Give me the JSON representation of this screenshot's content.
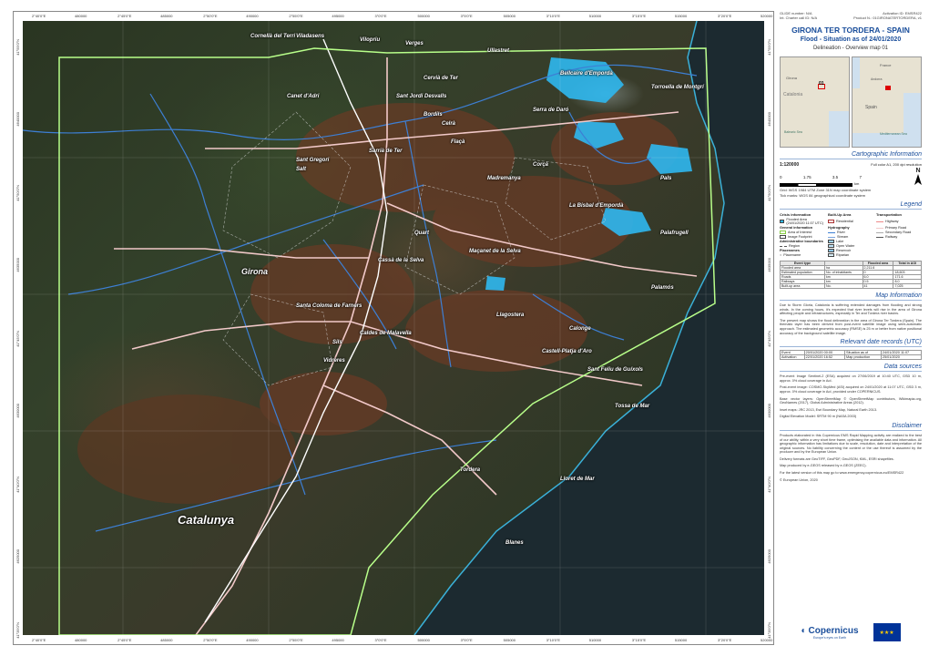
{
  "header": {
    "glide": "GLIDE number: N/A",
    "activation": "Activation ID: EMSR422",
    "charter": "Int. Charter call ID: N/A",
    "product": "Product N.: 01GIRONATERTORDERA, v1",
    "title": "GIRONA TER TORDERA - SPAIN",
    "subtitle": "Flood - Situation as of 24/01/2020",
    "subtitle2": "Delineation - Overview map 01"
  },
  "overview": {
    "labels": [
      "France",
      "Girona",
      "Catalonia",
      "Andorra",
      "Spain",
      "Mediterranean Sea",
      "Balearic Sea",
      "01"
    ]
  },
  "cartographic": {
    "section": "Cartographic Information",
    "scale": "1:120000",
    "print": "Full color A1, 200 dpi resolution",
    "scale_labels": [
      "0",
      "1.75",
      "3.5",
      "7"
    ],
    "scale_unit": "km",
    "crs1": "Grid: WGS 1984 UTM Zone 31N map coordinate system",
    "crs2": "Tick marks: WGS 84 geographical coordinate system",
    "north": "N"
  },
  "legend": {
    "section": "Legend",
    "col1_head": "Crisis information",
    "col2_head": "Built-Up Area",
    "col3_head": "Transportation",
    "items1": [
      "Flooded Area (24/01/2020 11:07 UTC)",
      "General information",
      "Area of Interest",
      "Image Footprint",
      "Administrative boundaries",
      "Region",
      "Placenames",
      "Placename"
    ],
    "items2": [
      "Residential",
      "Hydrography",
      "River",
      "Stream",
      "Lake",
      "Open Water",
      "Reservoir",
      "Riparian"
    ],
    "items3": [
      "Highway",
      "Primary Road",
      "Secondary Road",
      "Railway"
    ]
  },
  "table": {
    "h1": "Event type",
    "h2": "Flooded area",
    "h3": "Total in AOI",
    "r1": [
      "Flooded area",
      "ha",
      "2,211.6"
    ],
    "r2": [
      "Estimated population",
      "No. of inhabitants",
      "0",
      "18,603"
    ],
    "r3": [
      "Roads",
      "km",
      "6.0",
      "171.6"
    ],
    "r4": [
      "Railways",
      "km",
      "0.5",
      "8.0"
    ],
    "r5": [
      "Built-up area",
      "No.",
      "41",
      "7,025"
    ]
  },
  "map_info": {
    "section": "Map Information",
    "p1": "Due to Storm Gloria, Catalonia is suffering extended damages from flooding and strong winds. In the coming hours, it's expected that river levels will rise in the area of Girona affecting people and infrastructures, especially in Ter and Tordera river basins.",
    "p2": "The present map shows the flood delineation in the area of Girona Ter Tordera (Spain). The thematic layer has been derived from post-event satellite image using semi-automatic approach. The estimated geometric accuracy (RMSE) is 25 m or better from native positional accuracy of the background satellite image."
  },
  "dates": {
    "section": "Relevant date records (UTC)",
    "event_l": "Event",
    "event_v": "20/01/2020 00:00",
    "situation_l": "Situation as of",
    "situation_v": "24/01/2020 11:07",
    "activation_l": "Activation",
    "activation_v": "22/01/2020 16:52",
    "map_l": "Map production",
    "map_v": "25/01/2020"
  },
  "sources": {
    "section": "Data sources",
    "p1": "Pre-event Image Sentinel-2 (ESA) acquired on 27/06/2019 at 10:40 UTC, GSD 10 m, approx. 0% cloud coverage in AoI.",
    "p2": "Post-event image: COSMO-SkyMed (ASI) acquired on 24/01/2020 at 11:07 UTC, GSD 3 m, approx. 0% cloud coverage in AoI, provided under COPERNICUS.",
    "p3": "Base vector layers: OpenStreetMap © OpenStreetMap contributors, Wikimapia.org, GeoNames (2017), Global Administrative Areas (2012).",
    "p4": "Inset maps: JRC 2013, Esri Boundary Map, Natural Earth 2013.",
    "p5": "Digital Elevation Model: SRTM 90 m (NASA 2003)"
  },
  "disclaimer": {
    "section": "Disclaimer",
    "p1": "Products elaborated in this Copernicus EMS Rapid Mapping activity are realized to the best of our ability, within a very short time frame, optimising the available data and information. All geographic information has limitations due to scale, resolution, date and interpretation of the original sources. No liability concerning the content or the use thereof is assumed by the producer and by the European Union.",
    "p2": "Delivery formats are GeoTIFF, GeoPDF, GeoJSON, KML, ESRI shapefiles.",
    "p3": "Map produced by e-GEOS released by e-GEOS (ZEEC).",
    "p4": "For the latest version of this map go to www.emergency.copernicus.eu/EMSR422",
    "p5": "© European Union, 2020"
  },
  "logos": {
    "copernicus": "Copernicus",
    "copernicus_sub": "Europe's eyes on Earth"
  },
  "ticks": {
    "top": [
      "2°40'0\"E",
      "480000",
      "2°45'0\"E",
      "485000",
      "2°50'0\"E",
      "490000",
      "2°55'0\"E",
      "495000",
      "3°0'0\"E",
      "500000",
      "3°5'0\"E",
      "505000",
      "3°10'0\"E",
      "510000",
      "3°15'0\"E",
      "515000",
      "3°20'0\"E",
      "520000"
    ],
    "left": [
      "41°55'0\"N",
      "4640000",
      "41°50'0\"N",
      "4635000",
      "41°45'0\"N",
      "4630000",
      "41°40'0\"N",
      "4625000",
      "41°35'0\"N"
    ]
  },
  "places": [
    {
      "t": "Cornellà del Terri",
      "c": "place"
    },
    {
      "t": "Viladasens",
      "c": "place"
    },
    {
      "t": "Vilopriu",
      "c": "place"
    },
    {
      "t": "Verges",
      "c": "place"
    },
    {
      "t": "Ullastret",
      "c": "place"
    },
    {
      "t": "Torroella de Montgrí",
      "c": "place"
    },
    {
      "t": "Pals",
      "c": "place"
    },
    {
      "t": "Bellcaire d'Empordà",
      "c": "place"
    },
    {
      "t": "Serra de Daró",
      "c": "place"
    },
    {
      "t": "Cervià de Ter",
      "c": "place"
    },
    {
      "t": "Canet d'Adri",
      "c": "place"
    },
    {
      "t": "Sant Gregori",
      "c": "place"
    },
    {
      "t": "Sarrià de Ter",
      "c": "place"
    },
    {
      "t": "Girona",
      "c": "place big"
    },
    {
      "t": "Salt",
      "c": "place"
    },
    {
      "t": "Celrà",
      "c": "place"
    },
    {
      "t": "Bordils",
      "c": "place"
    },
    {
      "t": "Flaçà",
      "c": "place"
    },
    {
      "t": "Sant Jordi Desvalls",
      "c": "place"
    },
    {
      "t": "Madremanya",
      "c": "place"
    },
    {
      "t": "Corçà",
      "c": "place"
    },
    {
      "t": "La Bisbal d'Empordà",
      "c": "place"
    },
    {
      "t": "Palafrugell",
      "c": "place"
    },
    {
      "t": "Quart",
      "c": "place"
    },
    {
      "t": "Llagostera",
      "c": "place"
    },
    {
      "t": "Cassà de la Selva",
      "c": "place"
    },
    {
      "t": "Santa Coloma de Farners",
      "c": "place"
    },
    {
      "t": "Sils",
      "c": "place"
    },
    {
      "t": "Caldes de Malavella",
      "c": "place"
    },
    {
      "t": "Vidreres",
      "c": "place"
    },
    {
      "t": "Maçanet de la Selva",
      "c": "place"
    },
    {
      "t": "Tordera",
      "c": "place"
    },
    {
      "t": "Blanes",
      "c": "place"
    },
    {
      "t": "Lloret de Mar",
      "c": "place"
    },
    {
      "t": "Tossa de Mar",
      "c": "place"
    },
    {
      "t": "Sant Feliu de Guíxols",
      "c": "place"
    },
    {
      "t": "Castell-Platja d'Aro",
      "c": "place"
    },
    {
      "t": "Calonge",
      "c": "place"
    },
    {
      "t": "Palamós",
      "c": "place"
    },
    {
      "t": "Catalunya",
      "c": "place xl"
    }
  ]
}
